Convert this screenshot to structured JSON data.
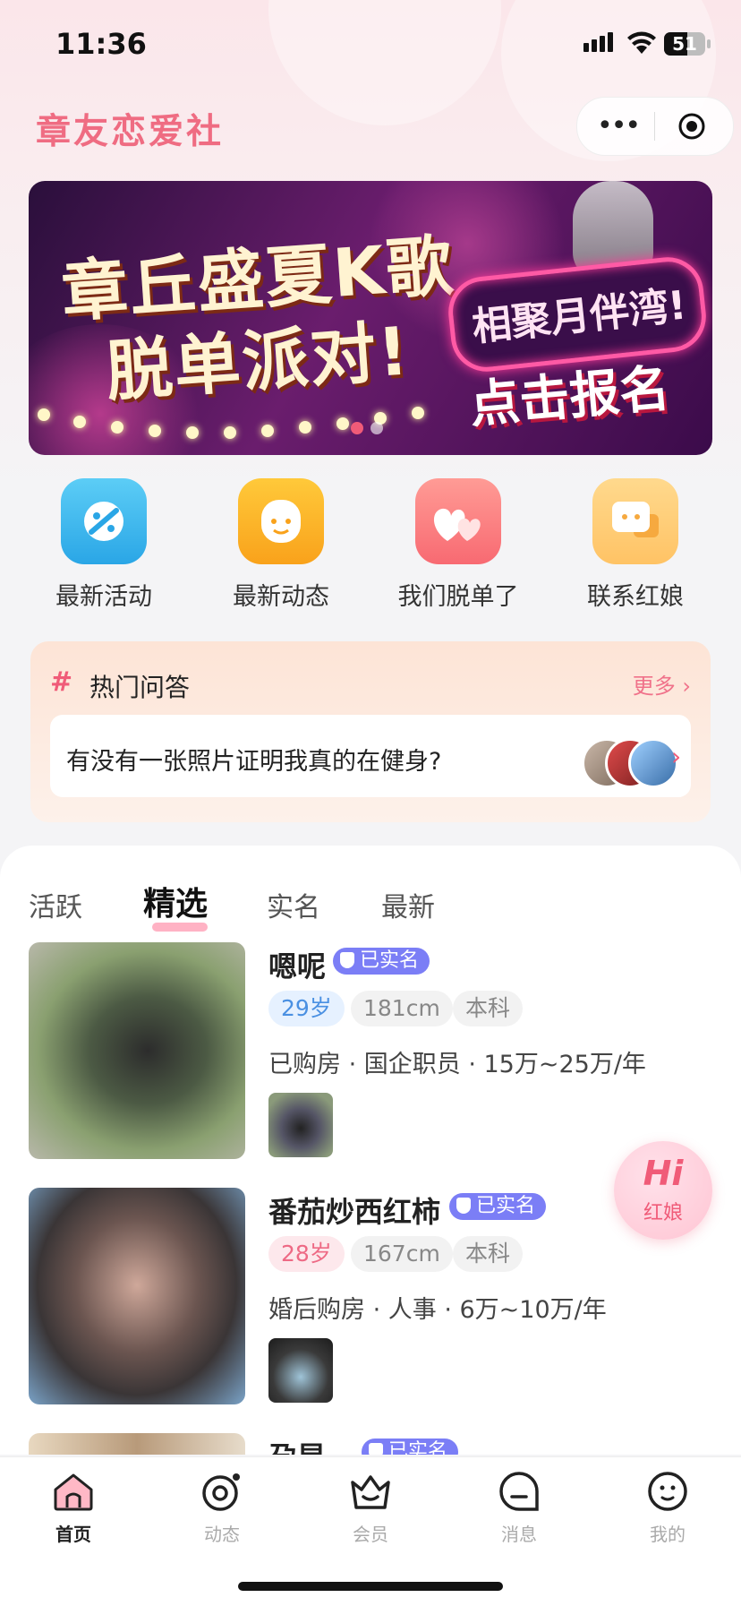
{
  "status_bar": {
    "time": "11:36",
    "battery": "51"
  },
  "header": {
    "app_title": "章友恋爱社"
  },
  "banner": {
    "headline_1": "章丘盛夏K歌",
    "headline_2": "脱单派对!",
    "neon_text": "相聚月伴湾!",
    "cta_text": "点击报名",
    "slide_count": 2,
    "active_slide": 0
  },
  "quick_entries": [
    {
      "label": "最新活动",
      "icon": "activity-icon",
      "color": "#3bb8ee"
    },
    {
      "label": "最新动态",
      "icon": "moments-icon",
      "color": "#fbb227"
    },
    {
      "label": "我们脱单了",
      "icon": "hearts-icon",
      "color": "#fb7a7a"
    },
    {
      "label": "联系红娘",
      "icon": "chat-icon",
      "color": "#ffc56b"
    }
  ],
  "hot_qa": {
    "title": "热门问答",
    "more": "更多",
    "question": "有没有一张照片证明我真的在健身?"
  },
  "tabs": [
    {
      "label": "活跃",
      "active": false
    },
    {
      "label": "精选",
      "active": true
    },
    {
      "label": "实名",
      "active": false
    },
    {
      "label": "最新",
      "active": false
    }
  ],
  "profiles": [
    {
      "name": "嗯呢",
      "verified": "已实名",
      "age": "29岁",
      "gender": "male",
      "height": "181cm",
      "education": "本科",
      "info": "已购房 · 国企职员 · 15万~25万/年"
    },
    {
      "name": "番茄炒西红柿",
      "verified": "已实名",
      "age": "28岁",
      "gender": "female",
      "height": "167cm",
      "education": "本科",
      "info": "婚后购房 · 人事 · 6万~10万/年"
    },
    {
      "name": "孕昱",
      "verified": "已实名"
    }
  ],
  "float_button": {
    "hi": "Hi",
    "label": "红娘"
  },
  "tabbar": [
    {
      "label": "首页",
      "icon": "home-icon",
      "active": true
    },
    {
      "label": "动态",
      "icon": "moments-tab-icon",
      "active": false
    },
    {
      "label": "会员",
      "icon": "crown-icon",
      "active": false
    },
    {
      "label": "消息",
      "icon": "message-icon",
      "active": false
    },
    {
      "label": "我的",
      "icon": "profile-icon",
      "active": false
    }
  ],
  "colors": {
    "brand": "#ef6c82",
    "verified_badge": "#7b7ef6"
  }
}
